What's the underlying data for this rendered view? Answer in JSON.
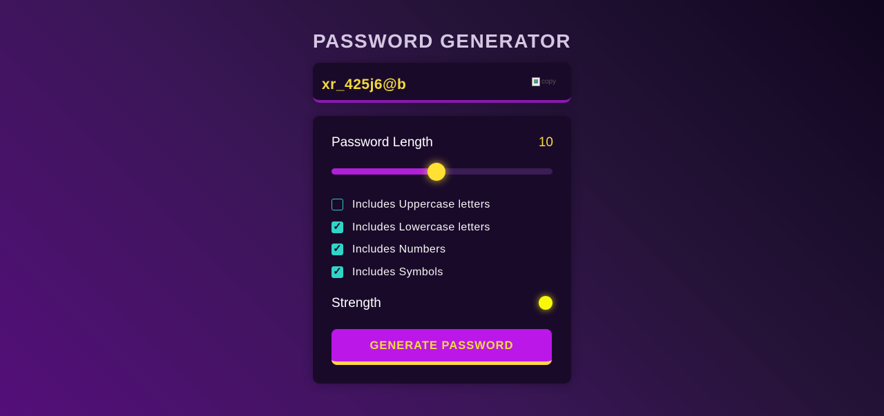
{
  "app": {
    "title": "PASSWORD GENERATOR"
  },
  "display": {
    "password": "xr_425j6@b",
    "copy_alt": "copy"
  },
  "length": {
    "label": "Password Length",
    "value": "10",
    "slider_fraction": 0.475
  },
  "options": [
    {
      "label": "Includes Uppercase letters",
      "checked": false
    },
    {
      "label": "Includes Lowercase letters",
      "checked": true
    },
    {
      "label": "Includes Numbers",
      "checked": true
    },
    {
      "label": "Includes Symbols",
      "checked": true
    }
  ],
  "strength": {
    "label": "Strength",
    "indicator_color": "#f8f80a"
  },
  "generate_button": {
    "label": "GENERATE PASSWORD"
  },
  "colors": {
    "accent_purple": "#bb17e9",
    "accent_yellow": "#f2da3c",
    "checkbox_teal": "#2fd6c8",
    "panel_bg": "#1a0a2a"
  }
}
